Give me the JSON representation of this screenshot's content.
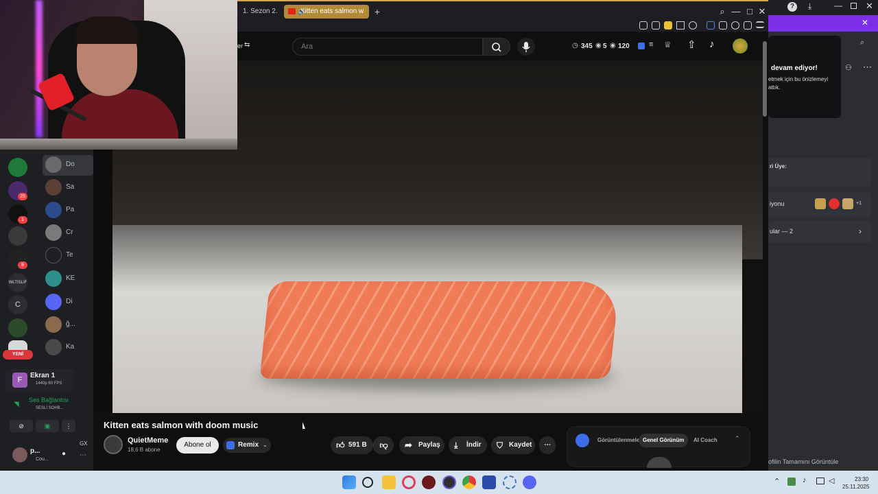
{
  "browser": {
    "tabs": [
      {
        "label": "1. Sezon 2. B"
      },
      {
        "label": "Kitten eats salmon w"
      }
    ],
    "new_tab": "+"
  },
  "youtube": {
    "left_label": "er",
    "search": {
      "placeholder": "Ara"
    },
    "stats": {
      "a": "345",
      "b": "5",
      "c": "120"
    },
    "video": {
      "title": "Kitten eats salmon with doom music",
      "channel": "QuietMeme",
      "subscribers": "18,6 B abone",
      "subscribe_label": "Abone ol",
      "remix_label": "Remix",
      "likes": "591 B",
      "share_label": "Paylaş",
      "download_label": "İndir",
      "save_label": "Kaydet"
    },
    "ai_panel": {
      "tabs": [
        "Görüntülenmeler",
        "Genel Görünüm",
        "AI Coach"
      ]
    }
  },
  "discord": {
    "servers": [
      {
        "label": "",
        "badge": ""
      },
      {
        "label": "",
        "badge": "25"
      },
      {
        "label": "",
        "badge": "1"
      },
      {
        "label": "",
        "badge": ""
      },
      {
        "label": "",
        "badge": "8"
      },
      {
        "label": "WLTISLIF",
        "badge": ""
      },
      {
        "label": "C",
        "badge": ""
      },
      {
        "label": "",
        "badge": ""
      }
    ],
    "dms": [
      {
        "name": "Do"
      },
      {
        "name": "Sa"
      },
      {
        "name": "Pa"
      },
      {
        "name": "Cr"
      },
      {
        "name": "Te"
      },
      {
        "name": "KE"
      },
      {
        "name": "Di"
      },
      {
        "name": "ğ..."
      },
      {
        "name": "Ka"
      }
    ],
    "new_label": "YENİ",
    "screen": {
      "title": "Ekran 1",
      "sub": "1440p 60 FPS",
      "icon": "F"
    },
    "voice": {
      "title": "Ses Bağlantısı",
      "sub": "SESLİ SOHB..."
    },
    "user": {
      "name": "p...",
      "status": "Cou..."
    },
    "gx": "GX"
  },
  "right_panel": {
    "card_title": "devam ediyor!",
    "card_text": "etmek için bu önizlemeyi attık.",
    "row1": "ri Üye:",
    "row2": "iyonu",
    "row2_extra": "+1",
    "row3": "ular — 2",
    "footer": "ofilin Tamamını Görüntüle"
  },
  "taskbar": {
    "time": "23:30",
    "date": "25.11.2025"
  },
  "colors": {
    "accent": "#b28a3a",
    "discord_bg": "#1e1f22",
    "purple_bar": "#7b2fe8",
    "yt_bg": "#0f0f0f"
  }
}
